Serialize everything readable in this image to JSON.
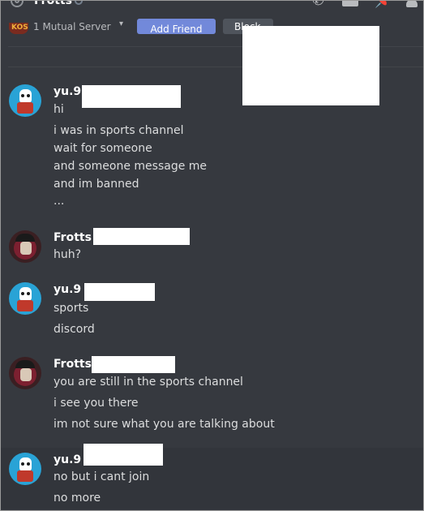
{
  "header": {
    "title": "Frotts",
    "icons": [
      "at-icon",
      "status-offline-icon",
      "call-icon",
      "video-icon",
      "pin-icon",
      "member-list-icon"
    ]
  },
  "profile": {
    "mutual_servers": "1 Mutual Server",
    "add_friend_label": "Add Friend",
    "block_label": "Block"
  },
  "messages": [
    {
      "author": "yu.9",
      "avatar": "papyrus-avatar",
      "lines": [
        "hi",
        "i was in sports channel",
        "wait for someone",
        "and someone message me",
        "and im banned",
        "..."
      ]
    },
    {
      "author": "Frotts",
      "avatar": "frotts-avatar",
      "lines": [
        "huh?"
      ]
    },
    {
      "author": "yu.9",
      "avatar": "papyrus-avatar",
      "lines": [
        "sports",
        "discord"
      ]
    },
    {
      "author": "Frotts",
      "avatar": "frotts-avatar",
      "lines": [
        "you are still in the sports channel",
        "i see you there",
        "im not sure what you are talking about"
      ]
    },
    {
      "author": "yu.9",
      "avatar": "papyrus-avatar",
      "lines": [
        "no but i cant join",
        "no more"
      ]
    }
  ],
  "colors": {
    "background": "#36393f",
    "accent": "#7289da",
    "text": "#dcddde",
    "username": "#ffffff"
  }
}
